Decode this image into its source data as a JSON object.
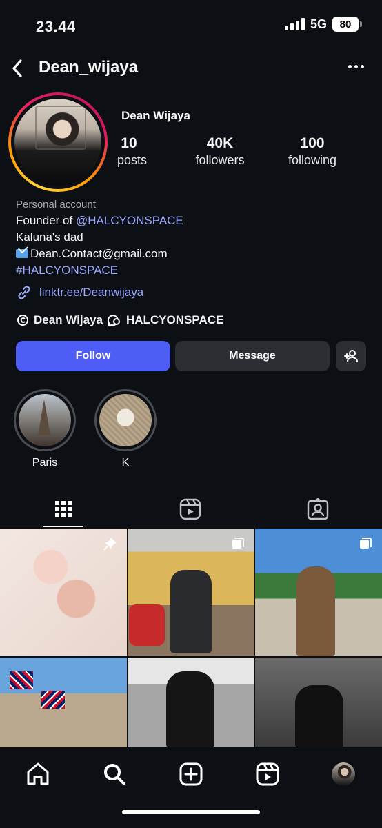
{
  "status_bar": {
    "time": "23.44",
    "network": "5G",
    "battery": "80"
  },
  "header": {
    "username": "Dean_wijaya"
  },
  "profile": {
    "display_name": "Dean Wijaya",
    "stats": [
      {
        "value": "10",
        "label": "posts"
      },
      {
        "value": "40K",
        "label": "followers"
      },
      {
        "value": "100",
        "label": "following"
      }
    ],
    "category": "Personal account",
    "bio": {
      "line1_prefix": "Founder of ",
      "line1_mention": "@HALCYONSPACE",
      "line2": "Kaluna's dad",
      "line3": "Dean.Contact@gmail.com",
      "line4": "#HALCYONSPACE"
    },
    "link": "linktr.ee/Deanwijaya",
    "threads_name": "Dean Wijaya",
    "threads_community": "HALCYONSPACE"
  },
  "actions": {
    "follow": "Follow",
    "message": "Message"
  },
  "highlights": [
    {
      "label": "Paris"
    },
    {
      "label": "K"
    }
  ],
  "colors": {
    "accent": "#4f5df7",
    "link": "#9aa9ff",
    "background": "#0c0f14"
  }
}
